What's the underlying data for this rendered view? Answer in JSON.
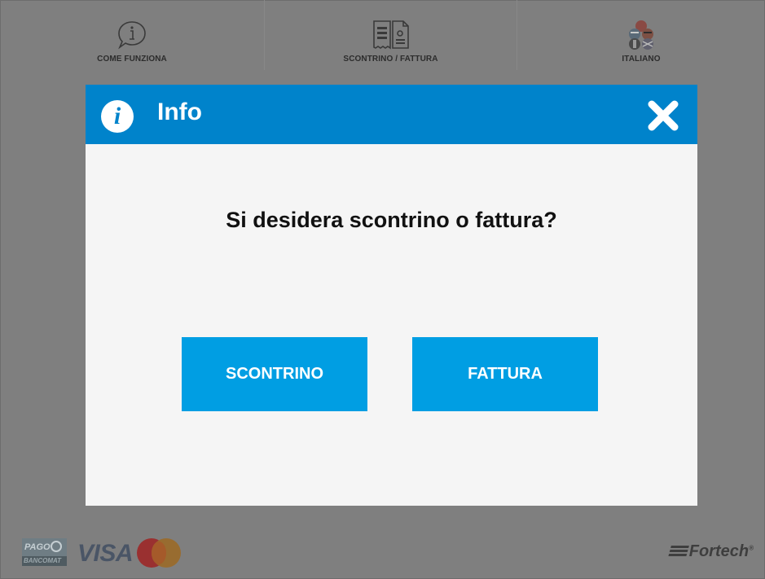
{
  "topbar": {
    "items": [
      {
        "label": "COME FUNZIONA",
        "icon": "info-bubble-icon"
      },
      {
        "label": "SCONTRINO / FATTURA",
        "icon": "receipt-invoice-icon"
      },
      {
        "label": "ITALIANO",
        "icon": "language-flags-icon"
      }
    ]
  },
  "dialog": {
    "title": "Info",
    "title_icon": "info-icon",
    "close_icon": "close-icon",
    "question": "Si desidera scontrino o fattura?",
    "buttons": [
      {
        "label": "SCONTRINO"
      },
      {
        "label": "FATTURA"
      }
    ]
  },
  "footer": {
    "payment_logos": [
      {
        "name": "pagobancomat-logo",
        "top": "PAGO",
        "bottom": "BANCOMAT"
      },
      {
        "name": "visa-logo",
        "text": "VISA"
      },
      {
        "name": "mastercard-logo"
      }
    ],
    "brand": "Fortech",
    "brand_mark": "®"
  },
  "colors": {
    "overlay": "#7f7f7f",
    "header": "#0083cb",
    "button": "#009ee3",
    "dialog_bg": "#f5f5f5"
  }
}
